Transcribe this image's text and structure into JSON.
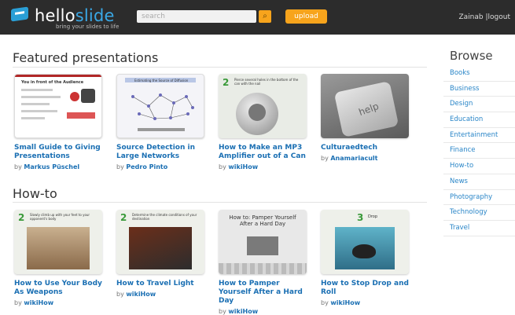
{
  "header": {
    "logo_a": "hello",
    "logo_b": "slide",
    "tagline": "bring your slides to life",
    "search_placeholder": "search",
    "search_icon": "search-icon",
    "upload_label": "upload",
    "user": "Zainab",
    "logout": "logout",
    "separator": "|"
  },
  "featured": {
    "heading": "Featured presentations",
    "items": [
      {
        "title": "Small Guide to Giving Presentations",
        "by": "by",
        "author": "Markus Püschel",
        "thumb_heading": "You in front of the Audience"
      },
      {
        "title": "Source Detection in Large Networks",
        "by": "by",
        "author": "Pedro Pinto",
        "thumb_heading": "Estimating the Source of Diffusion"
      },
      {
        "title": "How to Make an MP3 Amplifier out of a Can",
        "by": "by",
        "author": "wikiHow",
        "thumb_heading": "Pierce several holes in the bottom of the can with the nail",
        "thumb_num": "2"
      },
      {
        "title": "Culturaedtech",
        "by": "by",
        "author": "Anamariacult",
        "thumb_heading": "help"
      }
    ]
  },
  "howto": {
    "heading": "How-to",
    "items": [
      {
        "title": "How to Use Your Body As Weapons",
        "by": "by",
        "author": "wikiHow",
        "thumb_heading": "Slowly climb up with your feet to your opponent's body",
        "thumb_num": "2"
      },
      {
        "title": "How to Travel Light",
        "by": "by",
        "author": "wikiHow",
        "thumb_heading": "Determine the climate conditions of your destination",
        "thumb_num": "2"
      },
      {
        "title": "How to Pamper Yourself After a Hard Day",
        "by": "by",
        "author": "wikiHow",
        "thumb_heading": "How to: Pamper Yourself After a Hard Day"
      },
      {
        "title": "How to Stop Drop and Roll",
        "by": "by",
        "author": "wikiHow",
        "thumb_heading": "Drop",
        "thumb_num": "3"
      }
    ]
  },
  "browse": {
    "heading": "Browse",
    "items": [
      "Books",
      "Business",
      "Design",
      "Education",
      "Entertainment",
      "Finance",
      "How-to",
      "News",
      "Photography",
      "Technology",
      "Travel"
    ]
  }
}
